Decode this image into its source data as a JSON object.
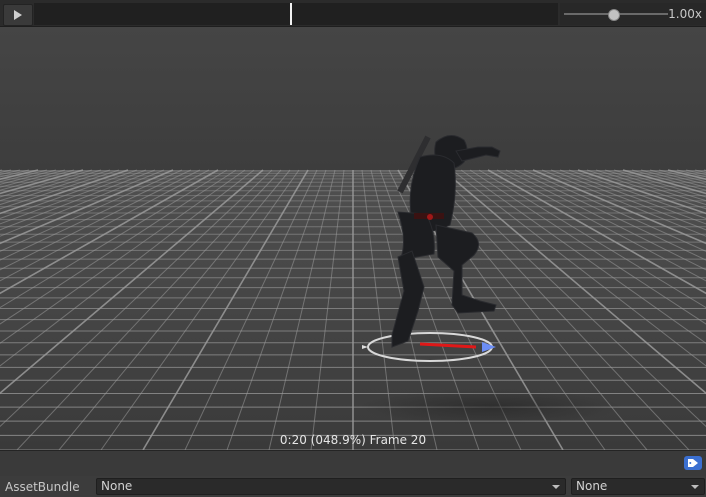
{
  "toolbar": {
    "play_icon": "play-icon",
    "speed_value": 1.0,
    "speed_label": "1.00x"
  },
  "timeline": {
    "progress": 0.489
  },
  "viewport": {
    "frame_readout": "0:20 (048.9%) Frame 20"
  },
  "footer": {
    "tag_icon": "tag-icon",
    "assetbundle_label": "AssetBundle",
    "bundle_name": "None",
    "bundle_variant": "None"
  },
  "colors": {
    "accent_blue": "#3b6fd0",
    "background": "#3c3c3c",
    "grid_line": "#9a9a9a"
  }
}
